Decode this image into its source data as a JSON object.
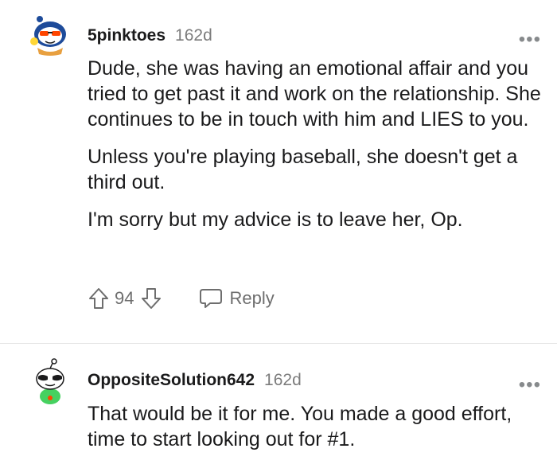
{
  "comments": [
    {
      "username": "5pinktoes",
      "age": "162d",
      "more_label": "•••",
      "paragraphs": [
        "Dude, she was having an emotional affair and you tried to get past it and work on the relationship. She continues to be in touch with him and LIES to you.",
        "Unless you're playing baseball, she doesn't get a third out.",
        "I'm sorry but my advice is to leave her, Op."
      ],
      "score": "94",
      "reply_label": "Reply",
      "avatar_icon": "snoo-avatar-sunglasses-icon"
    },
    {
      "username": "OppositeSolution642",
      "age": "162d",
      "more_label": "•••",
      "paragraphs": [
        "That would be it for me. You made a good effort, time to start looking out for #1."
      ],
      "avatar_icon": "snoo-avatar-shades-green-shirt-icon"
    }
  ],
  "colors": {
    "text": "#1a1a1b",
    "meta": "#7c7c7c",
    "action": "#6e6e6e",
    "divider": "#e6e6e6"
  }
}
